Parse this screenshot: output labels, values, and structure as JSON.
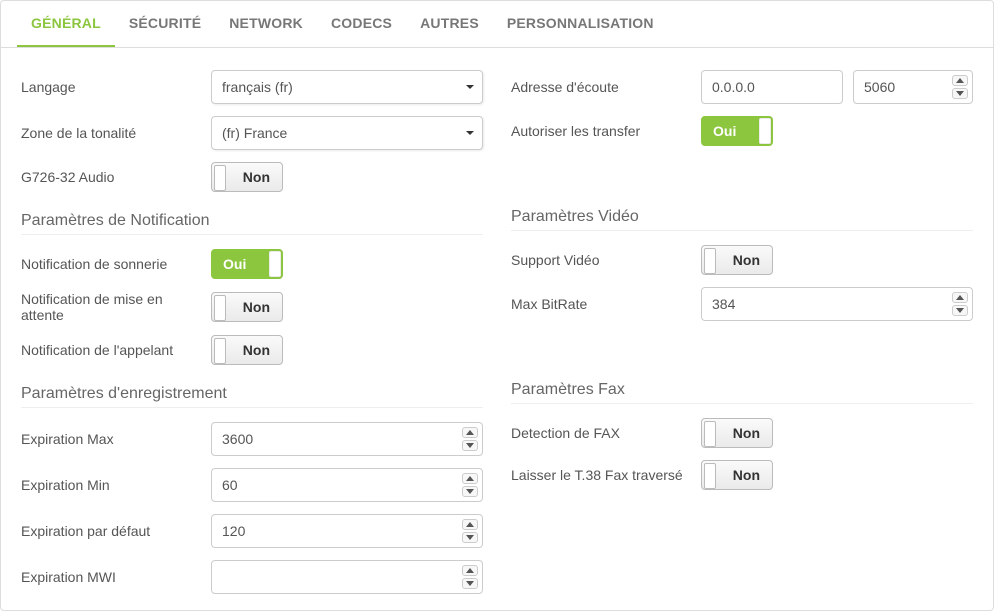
{
  "tabs": {
    "general": "GÉNÉRAL",
    "securite": "SÉCURITÉ",
    "network": "NETWORK",
    "codecs": "CODECS",
    "autres": "AUTRES",
    "personnalisation": "PERSONNALISATION"
  },
  "toggle": {
    "on": "Oui",
    "off": "Non"
  },
  "left": {
    "langage_lbl": "Langage",
    "langage_val": "français (fr)",
    "tonalite_lbl": "Zone de la tonalité",
    "tonalite_val": "(fr) France",
    "g726_lbl": "G726-32 Audio",
    "g726_on": false,
    "notif_h": "Paramètres de Notification",
    "ring_lbl": "Notification de sonnerie",
    "ring_on": true,
    "hold_lbl": "Notification de mise en attente",
    "hold_on": false,
    "cid_lbl": "Notification de l'appelant",
    "cid_on": false,
    "reg_h": "Paramètres d'enregistrement",
    "expmax_lbl": "Expiration Max",
    "expmax_val": "3600",
    "expmin_lbl": "Expiration Min",
    "expmin_val": "60",
    "expdef_lbl": "Expiration par défaut",
    "expdef_val": "120",
    "expmwi_lbl": "Expiration MWI",
    "expmwi_val": ""
  },
  "right": {
    "addr_lbl": "Adresse d'écoute",
    "addr_host": "0.0.0.0",
    "addr_port": "5060",
    "xfer_lbl": "Autoriser les transfer",
    "xfer_on": true,
    "video_h": "Paramètres Vidéo",
    "vidsup_lbl": "Support Vidéo",
    "vidsup_on": false,
    "bitrate_lbl": "Max BitRate",
    "bitrate_val": "384",
    "fax_h": "Paramètres Fax",
    "faxdet_lbl": "Detection de FAX",
    "faxdet_on": false,
    "t38_lbl": "Laisser le T.38 Fax traversé",
    "t38_on": false
  }
}
